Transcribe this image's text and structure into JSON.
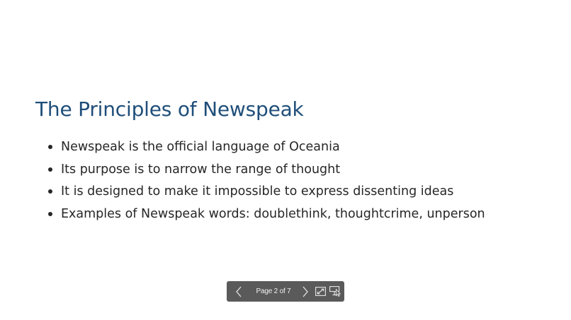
{
  "slide": {
    "title": "The Principles of Newspeak",
    "bullets": [
      "Newspeak is the official language of Oceania",
      "Its purpose is to narrow the range of thought",
      "It is designed to make it impossible to express dissenting ideas",
      "Examples of Newspeak words: doublethink, thoughtcrime, unperson"
    ]
  },
  "toolbar": {
    "page_label": "Page 2 of 7",
    "icons": {
      "previous": "chevron-left-icon",
      "next": "chevron-right-icon",
      "fullscreen": "fullscreen-icon",
      "pointer": "presenter-pointer-icon"
    }
  },
  "colors": {
    "title": "#1f4e79",
    "body_text": "#262626",
    "toolbar_bg": "#5a5a5a",
    "page_bg": "#ffffff"
  }
}
